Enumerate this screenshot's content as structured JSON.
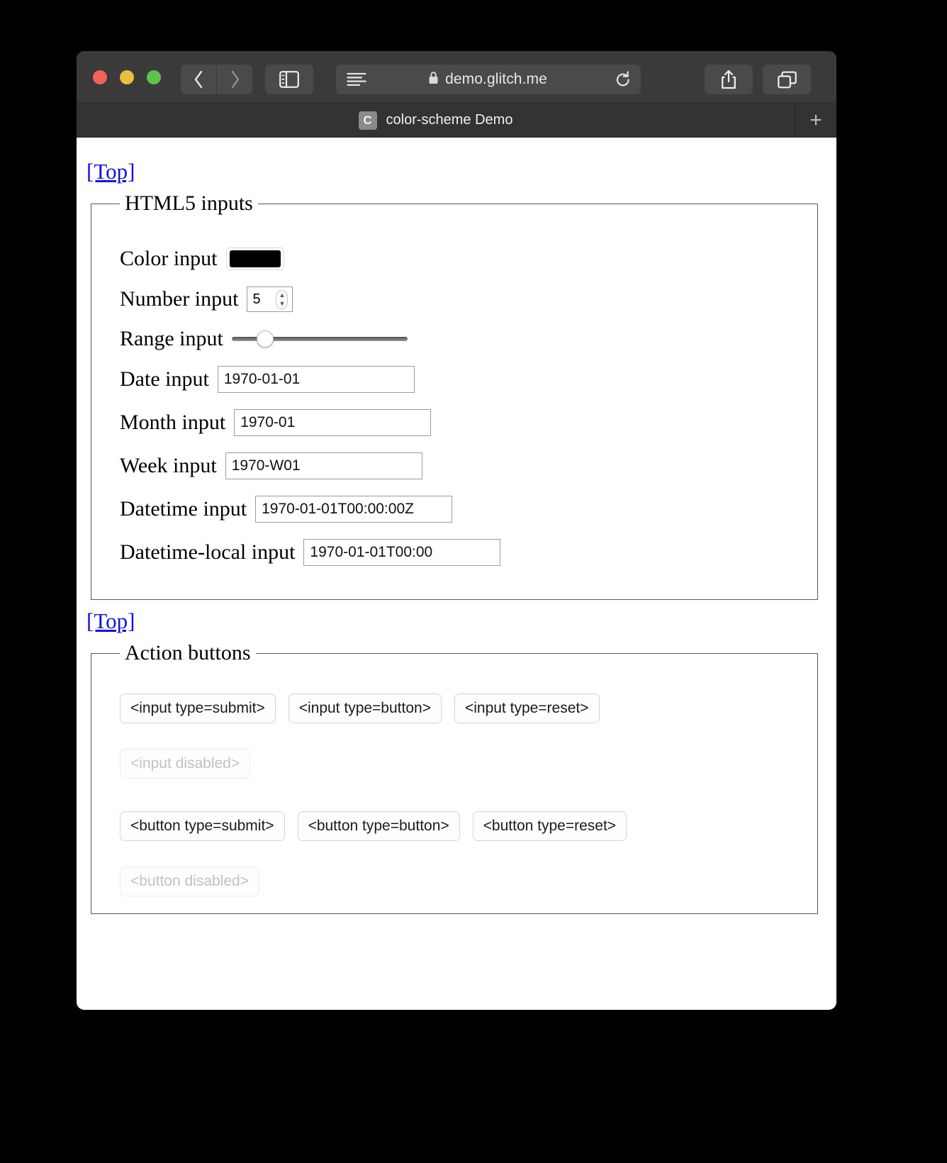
{
  "window": {
    "traffic_lights": [
      "close",
      "minimize",
      "maximize"
    ],
    "colors": {
      "close": "#f3625a",
      "minimize": "#e9c03c",
      "maximize": "#5fc24b",
      "link": "#1212dd"
    }
  },
  "toolbar": {
    "back_icon": "chevron-left-icon",
    "forward_icon": "chevron-right-icon",
    "sidebar_icon": "sidebar-icon",
    "reader_icon": "reader-view-icon",
    "lock_icon": "lock-icon",
    "url": "demo.glitch.me",
    "reload_icon": "reload-icon",
    "share_icon": "share-icon",
    "tabs_icon": "tab-overview-icon"
  },
  "tabstrip": {
    "tabs": [
      {
        "favicon_letter": "C",
        "title": "color-scheme Demo"
      }
    ],
    "new_tab_label": "+"
  },
  "page": {
    "top_link_1": "[Top]",
    "top_link_2": "[Top]",
    "html5_inputs": {
      "legend": "HTML5 inputs",
      "fields": [
        {
          "label": "Color input",
          "type": "color",
          "value": "#000000"
        },
        {
          "label": "Number input",
          "type": "number",
          "value": "5"
        },
        {
          "label": "Range input",
          "type": "range",
          "value": "14"
        },
        {
          "label": "Date input",
          "type": "date",
          "value": "1970-01-01"
        },
        {
          "label": "Month input",
          "type": "month",
          "value": "1970-01"
        },
        {
          "label": "Week input",
          "type": "week",
          "value": "1970-W01"
        },
        {
          "label": "Datetime input",
          "type": "datetime",
          "value": "1970-01-01T00:00:00Z"
        },
        {
          "label": "Datetime-local input",
          "type": "datetime-local",
          "value": "1970-01-01T00:00"
        }
      ]
    },
    "action_buttons": {
      "legend": "Action buttons",
      "input_row": [
        {
          "label": "<input type=submit>",
          "disabled": false
        },
        {
          "label": "<input type=button>",
          "disabled": false
        },
        {
          "label": "<input type=reset>",
          "disabled": false
        },
        {
          "label": "<input disabled>",
          "disabled": true
        }
      ],
      "button_row": [
        {
          "label": "<button type=submit>",
          "disabled": false
        },
        {
          "label": "<button type=button>",
          "disabled": false
        },
        {
          "label": "<button type=reset>",
          "disabled": false
        },
        {
          "label": "<button disabled>",
          "disabled": true
        }
      ]
    }
  }
}
